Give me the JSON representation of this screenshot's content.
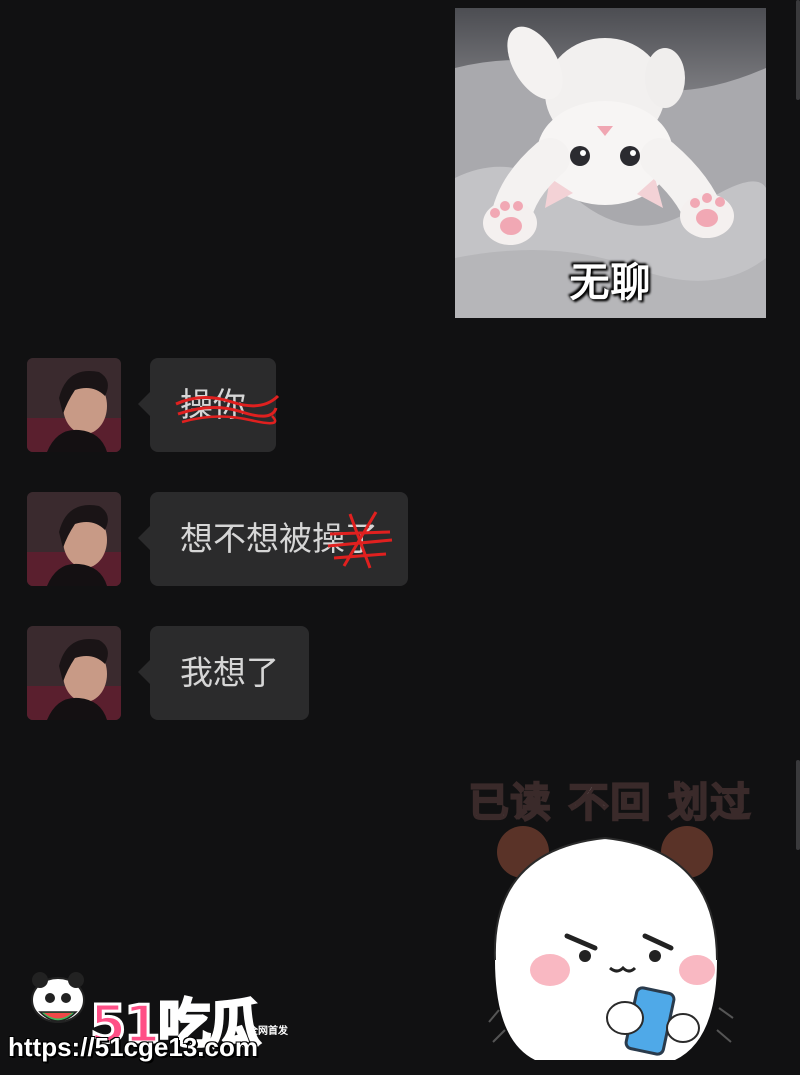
{
  "stickers": {
    "cat": {
      "caption": "无聊"
    },
    "panda": {
      "caption": "已读 不回 划过"
    }
  },
  "messages": [
    {
      "text": "操你",
      "scribbled": true
    },
    {
      "text": "想不想被操了",
      "scribbled": true
    },
    {
      "text": "我想了",
      "scribbled": false
    }
  ],
  "watermark": {
    "brand": "51吃瓜",
    "tag": "全网首发",
    "url": "https://51cge13.com"
  },
  "colors": {
    "background": "#111112",
    "bubble": "#2b2b2c",
    "bubble_text": "#d6d6d6",
    "scribble": "#e0201f",
    "brand_pink": "#ff4f86"
  }
}
